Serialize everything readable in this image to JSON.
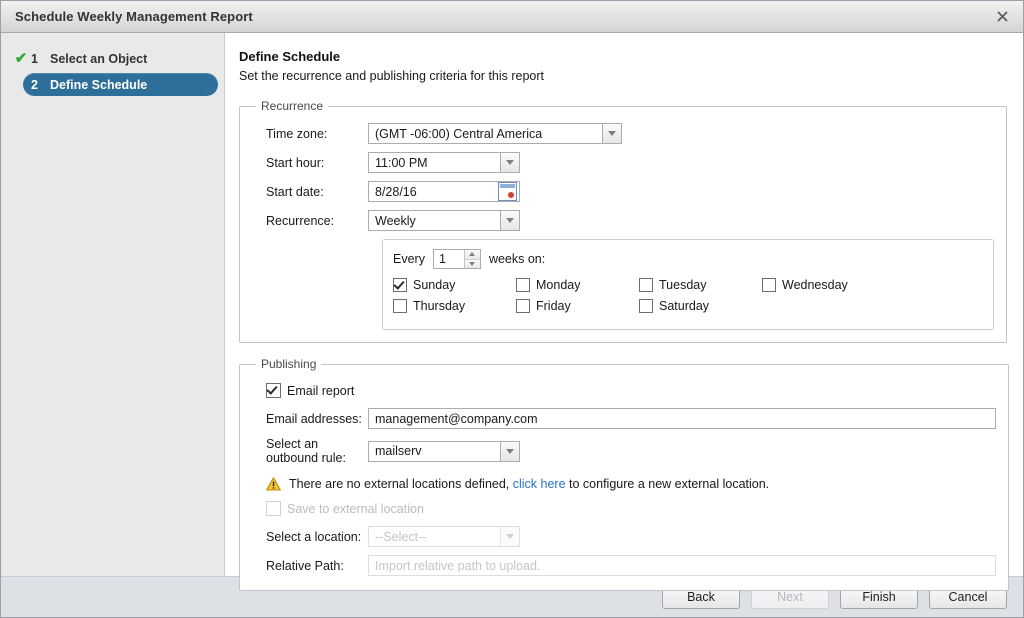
{
  "window": {
    "title": "Schedule Weekly Management Report",
    "close_icon": "close-icon"
  },
  "sidebar": {
    "steps": [
      {
        "num": "1",
        "label": "Select an Object",
        "state": "completed",
        "check": "✔"
      },
      {
        "num": "2",
        "label": "Define Schedule",
        "state": "active",
        "check": ""
      }
    ]
  },
  "main": {
    "title": "Define Schedule",
    "subtitle": "Set the recurrence and publishing criteria for this report",
    "recurrence": {
      "legend": "Recurrence",
      "timezone_label": "Time zone:",
      "timezone_value": "(GMT -06:00) Central America",
      "start_hour_label": "Start hour:",
      "start_hour_value": "11:00 PM",
      "start_date_label": "Start date:",
      "start_date_value": "8/28/16",
      "recurrence_label": "Recurrence:",
      "recurrence_value": "Weekly",
      "weekly": {
        "every_label": "Every",
        "interval_value": "1",
        "weeks_on_label": "weeks on:",
        "days": [
          {
            "label": "Sunday",
            "checked": true
          },
          {
            "label": "Monday",
            "checked": false
          },
          {
            "label": "Tuesday",
            "checked": false
          },
          {
            "label": "Wednesday",
            "checked": false
          },
          {
            "label": "Thursday",
            "checked": false
          },
          {
            "label": "Friday",
            "checked": false
          },
          {
            "label": "Saturday",
            "checked": false
          }
        ]
      }
    },
    "publishing": {
      "legend": "Publishing",
      "email_report_label": "Email report",
      "email_report_checked": true,
      "email_addresses_label": "Email addresses:",
      "email_addresses_value": "management@company.com",
      "outbound_rule_label_line1": "Select an",
      "outbound_rule_label_line2": "outbound rule:",
      "outbound_rule_value": "mailserv",
      "warning": {
        "icon": "warning-icon",
        "text_before": "There are no external locations defined, ",
        "link_text": "click here",
        "text_after": " to configure a new external location."
      },
      "save_external_label": "Save to external location",
      "save_external_checked": false,
      "select_location_label": "Select a location:",
      "select_location_value": "--Select--",
      "relative_path_label": "Relative Path:",
      "relative_path_placeholder": "Import relative path to upload."
    }
  },
  "footer": {
    "back": "Back",
    "next": "Next",
    "finish": "Finish",
    "cancel": "Cancel"
  },
  "colors": {
    "accent": "#2e6f99",
    "check_green": "#35a832",
    "link_blue": "#2a72c4",
    "warning_yellow": "#f5c531",
    "footer_bg": "#dde1e6"
  }
}
